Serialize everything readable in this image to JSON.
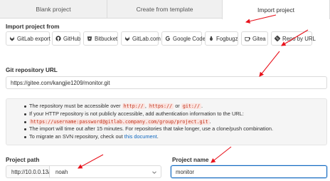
{
  "tabs": [
    {
      "label": "Blank project"
    },
    {
      "label": "Create from template"
    },
    {
      "label": "Import project"
    }
  ],
  "import_from": {
    "label": "Import project from",
    "sources": [
      {
        "label": "GitLab export",
        "icon": "gitlab-icon"
      },
      {
        "label": "GitHub",
        "icon": "github-icon"
      },
      {
        "label": "Bitbucket",
        "icon": "bitbucket-icon"
      },
      {
        "label": "GitLab.com",
        "icon": "gitlab-icon"
      },
      {
        "label": "Google Code",
        "icon": "google-icon"
      },
      {
        "label": "Fogbugz",
        "icon": "fogbugz-icon"
      },
      {
        "label": "Gitea",
        "icon": "gitea-icon"
      },
      {
        "label": "Repo by URL",
        "icon": "git-icon"
      }
    ]
  },
  "git_url": {
    "label": "Git repository URL",
    "value": "https://gitee.com/kangjie1209/monitor.git"
  },
  "info": {
    "l1_pre": "The repository must be accessible over ",
    "l1_c1": "http://",
    "l1_sep1": ", ",
    "l1_c2": "https://",
    "l1_sep2": " or ",
    "l1_c3": "git://",
    "l1_post": ".",
    "l2": "If your HTTP repository is not publicly accessible, add authentication information to the URL:",
    "l3_code": "https://username:password@gitlab.company.com/group/project.git",
    "l3_post": ".",
    "l4": "The import will time out after 15 minutes. For repositories that take longer, use a clone/push combination.",
    "l5_pre": "To migrate an SVN repository, check out ",
    "l5_link": "this document",
    "l5_post": "."
  },
  "project_path": {
    "label": "Project path",
    "prefix": "http://10.0.0.13/",
    "namespace": "noah"
  },
  "project_name": {
    "label": "Project name",
    "value": "monitor"
  },
  "colors": {
    "annotation_arrow": "#e8121c",
    "focus_border": "#1068bf",
    "code_text": "#c0341d"
  }
}
